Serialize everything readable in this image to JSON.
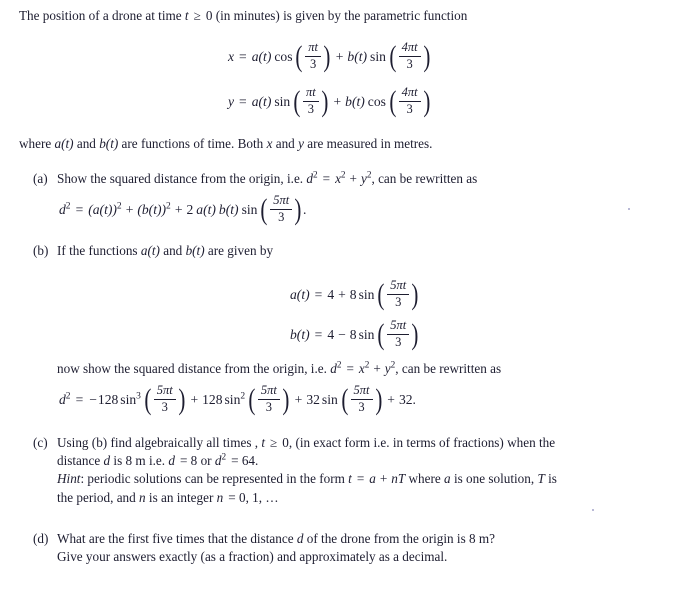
{
  "document": {
    "type": "mathematics-problem-sheet",
    "background_color": "#ffffff",
    "text_color": "#1d1d30"
  },
  "intro": {
    "line1_part1": "The position of a drone at time ",
    "line1_var_t": "t",
    "line1_ge": "≥",
    "line1_zero": "0",
    "line1_part2": " (in minutes) is given by the parametric function"
  },
  "equation_x": {
    "lhs": "x",
    "eq": "=",
    "a_of_t": "a(t)",
    "fn1": "cos",
    "arg1_num": "πt",
    "arg1_den": "3",
    "plus": "+",
    "b_of_t": "b(t)",
    "fn2": "sin",
    "arg2_num": "4πt",
    "arg2_den": "3"
  },
  "equation_y": {
    "lhs": "y",
    "eq": "=",
    "a_of_t": "a(t)",
    "fn1": "sin",
    "arg1_num": "πt",
    "arg1_den": "3",
    "plus": "+",
    "b_of_t": "b(t)",
    "fn2": "cos",
    "arg2_num": "4πt",
    "arg2_den": "3"
  },
  "where_line": {
    "text1": "where ",
    "a_of_t": "a(t)",
    "text2": " and ",
    "b_of_t": "b(t)",
    "text3": " are functions of time. Both ",
    "x": "x",
    "text4": " and ",
    "y": "y",
    "text5": " are measured in metres."
  },
  "parts": [
    {
      "label": "(a)",
      "line1_text1": "Show the squared distance from the origin, i.e. ",
      "line1_d": "d",
      "line1_d_sup": "2",
      "line1_eq": "=",
      "line1_x": "x",
      "line1_x_sup": "2",
      "line1_plus": "+",
      "line1_y": "y",
      "line1_y_sup": "2",
      "line1_text2": ", can be rewritten as"
    },
    {
      "label": "(b)",
      "line1_text1": "If the functions ",
      "line1_a": "a(t)",
      "line1_text2": " and ",
      "line1_b": "b(t)",
      "line1_text3": " are given by"
    },
    {
      "label": "(c)",
      "lines": [
        "Using (b) find algebraically all times , t ≥ 0, (in exact form i.e. in terms of fractions) when the",
        "distance d is 8 m i.e. d = 8 or d² = 64.",
        "Hint: periodic solutions can be represented in the form t = a + nT where a is one solution, T is",
        "the period, and n is an integer n = 0, 1, …"
      ]
    },
    {
      "label": "(d)",
      "lines": [
        "What are the first five times that the distance d of the drone from the origin is 8 m?",
        "Give your answers exactly (as a fraction) and approximately as a decimal."
      ]
    }
  ],
  "equation_a_squared": {
    "lhs_d": "d",
    "lhs_sup": "2",
    "eq": "=",
    "term1": "(a(t))",
    "term1_sup": "2",
    "plus1": "+",
    "term2": "(b(t))",
    "term2_sup": "2",
    "plus2": "+",
    "coef": "2",
    "factor_a": "a(t)",
    "factor_b": "b(t)",
    "fn": "sin",
    "arg_num": "5πt",
    "arg_den": "3",
    "period": "."
  },
  "equation_at": {
    "lhs": "a(t)",
    "eq": "=",
    "const": "4",
    "sign": "+",
    "coef": "8",
    "fn": "sin",
    "arg_num": "5πt",
    "arg_den": "3"
  },
  "equation_bt": {
    "lhs": "b(t)",
    "eq": "=",
    "const": "4",
    "sign": "−",
    "coef": "8",
    "fn": "sin",
    "arg_num": "5πt",
    "arg_den": "3"
  },
  "now_show_line": {
    "text1": "now show the squared distance from the origin, i.e. ",
    "d": "d",
    "d_sup": "2",
    "eq": "=",
    "x": "x",
    "x_sup": "2",
    "plus": "+",
    "y": "y",
    "y_sup": "2",
    "text2": ", can be rewritten as"
  },
  "equation_d_expanded": {
    "lhs_d": "d",
    "lhs_sup": "2",
    "eq": "=",
    "sign1": "−",
    "coef1": "128",
    "fn1": "sin",
    "fn1_sup": "3",
    "arg1_num": "5πt",
    "arg1_den": "3",
    "plus1": "+",
    "coef2": "128",
    "fn2": "sin",
    "fn2_sup": "2",
    "arg2_num": "5πt",
    "arg2_den": "3",
    "plus2": "+",
    "coef3": "32",
    "fn3": "sin",
    "arg3_num": "5πt",
    "arg3_den": "3",
    "plus3": "+",
    "const": "32",
    "period": "."
  },
  "part_c": {
    "line1_a": "Using (b) find algebraically all times , ",
    "line1_t": "t",
    "line1_ge": "≥",
    "line1_zero": "0",
    "line1_b": ", (in exact form i.e. in terms of fractions) when the",
    "line2_a": "distance ",
    "line2_d": "d",
    "line2_b": " is 8 m i.e. ",
    "line2_d2": "d",
    "line2_eq8": "= 8",
    "line2_or": " or ",
    "line2_d3": "d",
    "line2_sup": "2",
    "line2_eq64": "= 64.",
    "line3_hint": "Hint",
    "line3_a": ": periodic solutions can be represented in the form ",
    "line3_t": "t",
    "line3_eq": "=",
    "line3_a_var": "a",
    "line3_plus": "+",
    "line3_nT": "nT",
    "line3_b": " where ",
    "line3_a_var2": "a",
    "line3_c": " is one solution, ",
    "line3_T": "T",
    "line3_d": " is",
    "line4_a": "the period, and ",
    "line4_n": "n",
    "line4_b": " is an integer ",
    "line4_n2": "n",
    "line4_c": "= 0, 1, …"
  },
  "part_d": {
    "line1_a": "What are the first five times that the distance ",
    "line1_d": "d",
    "line1_b": " of the drone from the origin is 8 m?",
    "line2": "Give your answers exactly (as a fraction) and approximately as a decimal."
  }
}
